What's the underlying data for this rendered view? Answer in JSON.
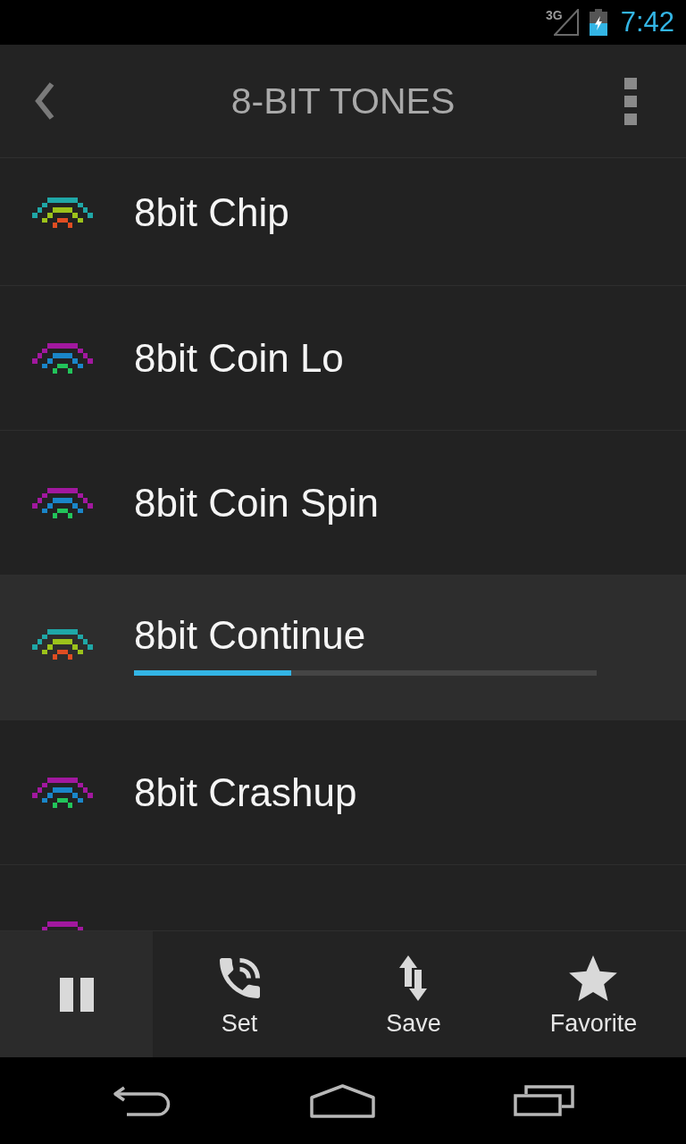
{
  "status_bar": {
    "network": "3G",
    "time": "7:42"
  },
  "action_bar": {
    "title": "8-BIT TONES"
  },
  "tones": [
    {
      "name": "8bit Chip",
      "icon_bands": [
        {
          "color": "#1fa7a7"
        },
        {
          "color": "#9cc21b"
        },
        {
          "color": "#e04d22"
        }
      ],
      "selected": false
    },
    {
      "name": "8bit Coin Lo",
      "icon_bands": [
        {
          "color": "#a2189f"
        },
        {
          "color": "#1a86c9"
        },
        {
          "color": "#22c45a"
        }
      ],
      "selected": false
    },
    {
      "name": "8bit Coin Spin",
      "icon_bands": [
        {
          "color": "#a2189f"
        },
        {
          "color": "#1a86c9"
        },
        {
          "color": "#22c45a"
        }
      ],
      "selected": false
    },
    {
      "name": "8bit Continue",
      "icon_bands": [
        {
          "color": "#1fa7a7"
        },
        {
          "color": "#9cc21b"
        },
        {
          "color": "#e04d22"
        }
      ],
      "selected": true,
      "level": 0.34
    },
    {
      "name": "8bit Crashup",
      "icon_bands": [
        {
          "color": "#a2189f"
        },
        {
          "color": "#1a86c9"
        },
        {
          "color": "#22c45a"
        }
      ],
      "selected": false
    }
  ],
  "next_row_peek": {
    "icon_bands": [
      {
        "color": "#a2189f"
      }
    ]
  },
  "bottom_bar": {
    "playing": true,
    "actions": [
      {
        "kind": "ringtone",
        "label": "Set"
      },
      {
        "kind": "save",
        "label": "Save"
      },
      {
        "kind": "favorite",
        "label": "Favorite"
      }
    ]
  }
}
